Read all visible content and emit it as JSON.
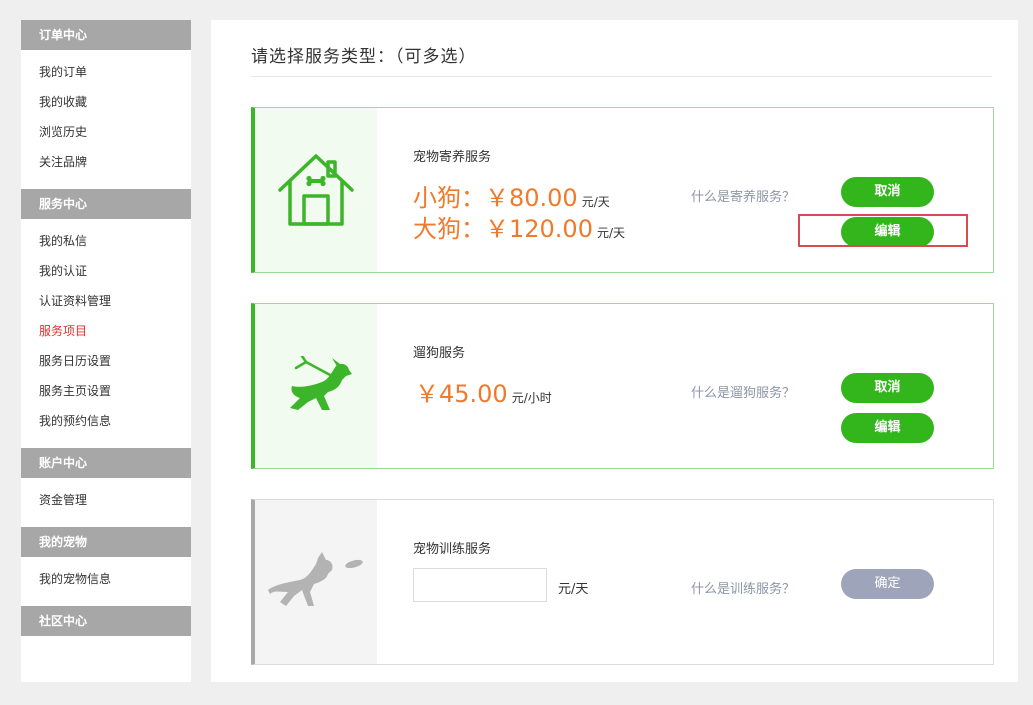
{
  "sidebar": {
    "sections": [
      {
        "title": "订单中心",
        "items": [
          "我的订单",
          "我的收藏",
          "浏览历史",
          "关注品牌"
        ]
      },
      {
        "title": "服务中心",
        "items": [
          "我的私信",
          "我的认证",
          "认证资料管理",
          "服务项目",
          "服务日历设置",
          "服务主页设置",
          "我的预约信息"
        ]
      },
      {
        "title": "账户中心",
        "items": [
          "资金管理"
        ]
      },
      {
        "title": "我的宠物",
        "items": [
          "我的宠物信息"
        ]
      },
      {
        "title": "社区中心",
        "items": []
      }
    ],
    "active_item": "服务项目"
  },
  "main": {
    "title": "请选择服务类型：（可多选）",
    "services": [
      {
        "name": "宠物寄养服务",
        "icon": "dog-house-icon",
        "prices": [
          {
            "text": "小狗：￥80.00",
            "unit": "元/天"
          },
          {
            "text": "大狗：￥120.00",
            "unit": "元/天"
          }
        ],
        "help": "什么是寄养服务？",
        "cancel_label": "取消",
        "edit_label": "编辑"
      },
      {
        "name": "遛狗服务",
        "icon": "dog-walking-icon",
        "price": {
          "text": "￥45.00",
          "unit": "元/小时"
        },
        "help": "什么是遛狗服务？",
        "cancel_label": "取消",
        "edit_label": "编辑"
      },
      {
        "name": "宠物训练服务",
        "icon": "dog-frisbee-icon",
        "input_value": "",
        "unit": "元/天",
        "help": "什么是训练服务？",
        "confirm_label": "确定"
      }
    ]
  },
  "colors": {
    "accent_green": "#33b51c",
    "price_orange": "#f07a2c",
    "active_red": "#e03030",
    "disabled_button": "#9ea5ba"
  }
}
